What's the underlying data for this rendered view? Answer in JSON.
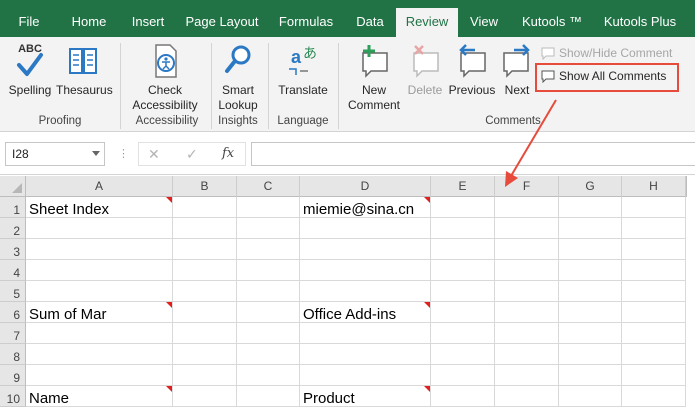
{
  "menu": {
    "tabs": [
      "File",
      "Home",
      "Insert",
      "Page Layout",
      "Formulas",
      "Data",
      "Review",
      "View",
      "Kutools ™",
      "Kutools Plus"
    ],
    "active": "Review"
  },
  "ribbon": {
    "proofing": {
      "label": "Proofing",
      "spelling": "Spelling",
      "thesaurus": "Thesaurus"
    },
    "accessibility": {
      "label": "Accessibility",
      "check_line1": "Check",
      "check_line2": "Accessibility"
    },
    "insights": {
      "label": "Insights",
      "smart_line1": "Smart",
      "smart_line2": "Lookup"
    },
    "language": {
      "label": "Language",
      "translate": "Translate"
    },
    "comments": {
      "label": "Comments",
      "new_line1": "New",
      "new_line2": "Comment",
      "delete": "Delete",
      "previous": "Previous",
      "next": "Next",
      "show_hide": "Show/Hide Comment",
      "show_all": "Show All Comments"
    },
    "abc_text": "ABC"
  },
  "formula_bar": {
    "name_box": "I28",
    "cancel_symbol": "✕",
    "enter_symbol": "✓",
    "fx_symbol": "fx",
    "content": ""
  },
  "grid": {
    "columns": [
      "A",
      "B",
      "C",
      "D",
      "E",
      "F",
      "G",
      "H"
    ],
    "rows": [
      "1",
      "2",
      "3",
      "4",
      "5",
      "6",
      "7",
      "8",
      "9",
      "10"
    ],
    "cells": {
      "A1": "Sheet Index",
      "D1": "miemie@sina.cn",
      "A6": "Sum of Mar",
      "D6": "Office Add-ins",
      "A10": "Name",
      "D10": "Product"
    }
  },
  "colors": {
    "excel_green": "#217346",
    "highlight_red": "#e64b3c",
    "comment_indicator": "#e0201e",
    "icon_blue": "#2b78c4"
  }
}
